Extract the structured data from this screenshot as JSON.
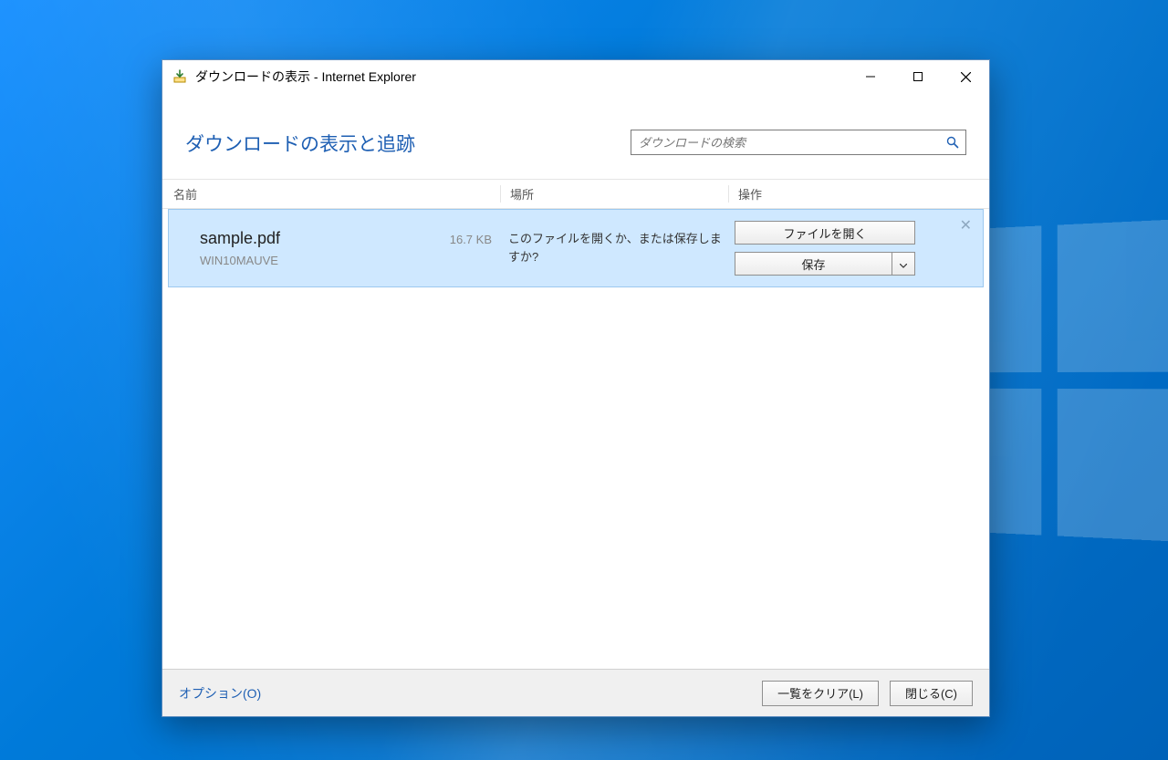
{
  "window": {
    "title": "ダウンロードの表示 - Internet Explorer"
  },
  "header": {
    "page_title": "ダウンロードの表示と追跡"
  },
  "search": {
    "placeholder": "ダウンロードの検索"
  },
  "columns": {
    "name": "名前",
    "location": "場所",
    "actions": "操作"
  },
  "downloads": [
    {
      "file_name": "sample.pdf",
      "size": "16.7 KB",
      "host": "WIN10MAUVE",
      "message": "このファイルを開くか、または保存しますか?",
      "open_label": "ファイルを開く",
      "save_label": "保存"
    }
  ],
  "footer": {
    "options": "オプション(O)",
    "clear_list": "一覧をクリア(L)",
    "close": "閉じる(C)"
  }
}
